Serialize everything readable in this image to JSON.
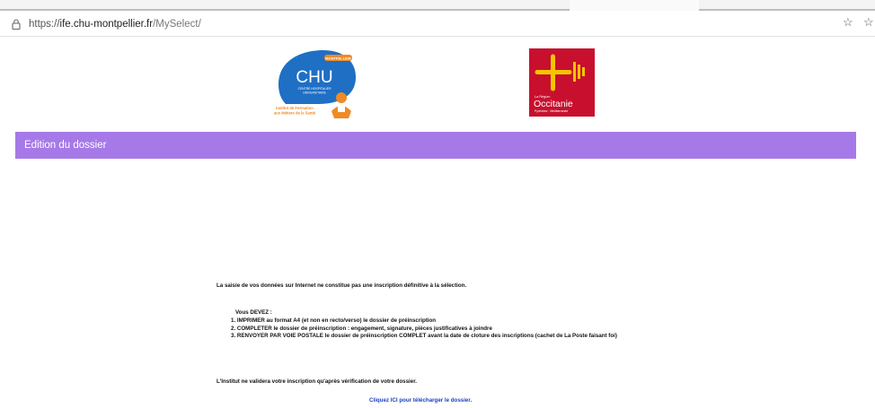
{
  "browser": {
    "url_protocol": "https://",
    "url_host": "ife.chu-montpellier.fr",
    "url_path": "/MySelect/",
    "star_glyph": "☆",
    "icons": [
      "lock-icon",
      "star-icon",
      "favorites-icon"
    ]
  },
  "logos": {
    "chu": {
      "badge": "MONTPELLIER",
      "mark": "CHU",
      "subtitle_lines": [
        "CENTRE HOSPITALIER",
        "UNIVERSITAIRE"
      ],
      "institute_lines": [
        "Institut de Formation",
        "aux Métiers de la Santé"
      ]
    },
    "occitanie": {
      "small_lines": [
        "La Région"
      ],
      "name": "Occitanie",
      "region_line": "Pyrénées · Méditerranée"
    }
  },
  "banner": {
    "title": "Edition du dossier",
    "color": "#a679e8"
  },
  "content": {
    "notice": "La saisie de vos données sur Internet ne constitue pas une inscription définitive à la sélection.",
    "must_title": "Vous DEVEZ :",
    "steps": [
      "1. IMPRIMER au format A4 (et non en recto/verso) le dossier de préinscription",
      "2. COMPLETER le dossier de préinscription : engagement, signature, pièces justificatives à joindre",
      "3. RENVOYER PAR VOIE POSTALE le dossier de préinscription COMPLET avant la date de cloture des inscriptions (cachet de La Poste faisant foi)"
    ],
    "validation": "L'Institut ne validera votre inscription qu'après vérification de votre dossier.",
    "download_link": "Cliquez ICI pour télécharger le dossier."
  },
  "colors": {
    "link": "#1a3fbf",
    "chu_blue": "#1f6fc5",
    "chu_orange": "#f08a24",
    "occitanie_red": "#c8102e",
    "occitanie_cross": "#f5c400"
  }
}
